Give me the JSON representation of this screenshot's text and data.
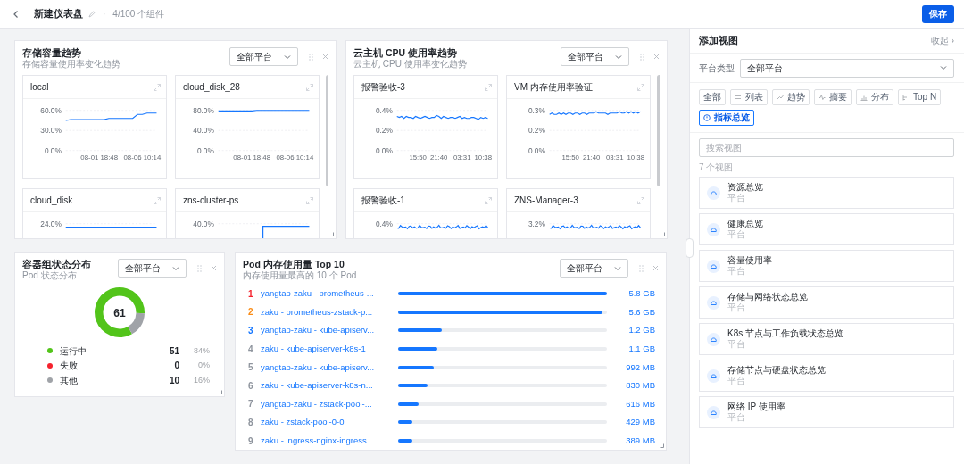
{
  "header": {
    "title": "新建仪表盘",
    "separator": "·",
    "count": "4/100 个组件",
    "save_button": "保存"
  },
  "widgets": [
    {
      "kind": "trend_grid",
      "title": "存储容量趋势",
      "subtitle": "存储容量使用率变化趋势",
      "platform_select": "全部平台",
      "charts": [
        {
          "kind": "line_chart",
          "title": "local",
          "chart_data": {
            "type": "line",
            "categories": [
              null,
              null,
              null,
              null,
              null,
              null,
              null,
              "08-01 18:48",
              null,
              null,
              null,
              null,
              null,
              null,
              null,
              null,
              "08-06 10:14",
              null,
              null,
              null
            ],
            "ylim": [
              0,
              60
            ],
            "yticks": [
              {
                "value": 0,
                "label": "0.0%"
              },
              {
                "value": 30,
                "label": "30.0%"
              },
              {
                "value": 60,
                "label": "60.0%"
              }
            ],
            "series": [
              {
                "color": "#1677ff",
                "values": [
                  45,
                  46,
                  46,
                  46,
                  46,
                  46,
                  46,
                  46,
                  46,
                  48,
                  48,
                  48,
                  48,
                  48,
                  48,
                  54,
                  54,
                  56,
                  56,
                  56
                ]
              }
            ]
          }
        },
        {
          "kind": "line_chart",
          "title": "cloud_disk_28",
          "chart_data": {
            "type": "line",
            "categories": [
              null,
              null,
              null,
              null,
              null,
              null,
              null,
              "08-01 18:48",
              null,
              null,
              null,
              null,
              null,
              null,
              null,
              null,
              "08-06 10:14",
              null,
              null,
              null
            ],
            "ylim": [
              0,
              80
            ],
            "yticks": [
              {
                "value": 0,
                "label": "0.0%"
              },
              {
                "value": 40,
                "label": "40.0%"
              },
              {
                "value": 80,
                "label": "80.0%"
              }
            ],
            "series": [
              {
                "color": "#1677ff",
                "values": [
                  79,
                  79,
                  79,
                  79,
                  79,
                  79,
                  79,
                  79,
                  80,
                  80,
                  80,
                  80,
                  80,
                  80,
                  80,
                  80,
                  80,
                  80,
                  80,
                  80
                ]
              }
            ]
          }
        },
        {
          "kind": "flat_trace",
          "title": "cloud_disk",
          "tick_labels": [
            "24.0%"
          ]
        },
        {
          "kind": "step_trace",
          "title": "zns-cluster-ps",
          "tick_labels": [
            "40.0%"
          ]
        }
      ]
    },
    {
      "kind": "trend_grid",
      "title": "云主机 CPU 使用率趋势",
      "subtitle": "云主机 CPU 使用率变化趋势",
      "platform_select": "全部平台",
      "charts": [
        {
          "kind": "line_chart",
          "title": "报警验收-3",
          "chart_data": {
            "type": "line",
            "categories": [
              null,
              null,
              null,
              null,
              null,
              null,
              null,
              null,
              null,
              "15:50",
              null,
              null,
              null,
              null,
              null,
              null,
              null,
              null,
              "21:40",
              null,
              null,
              null,
              null,
              null,
              null,
              null,
              null,
              null,
              "03:31",
              null,
              null,
              null,
              null,
              null,
              null,
              null,
              null,
              "10:38",
              null,
              null
            ],
            "ylim": [
              0,
              0.4
            ],
            "yticks": [
              {
                "value": 0,
                "label": "0.0%"
              },
              {
                "value": 0.2,
                "label": "0.2%"
              },
              {
                "value": 0.4,
                "label": "0.4%"
              }
            ],
            "series": [
              {
                "color": "#1677ff",
                "values": [
                  0.34,
                  0.33,
                  0.34,
                  0.32,
                  0.34,
                  0.33,
                  0.33,
                  0.32,
                  0.34,
                  0.33,
                  0.32,
                  0.33,
                  0.34,
                  0.33,
                  0.32,
                  0.33,
                  0.33,
                  0.35,
                  0.34,
                  0.32,
                  0.34,
                  0.33,
                  0.32,
                  0.33,
                  0.33,
                  0.32,
                  0.33,
                  0.34,
                  0.32,
                  0.33,
                  0.32,
                  0.32,
                  0.33,
                  0.33,
                  0.32,
                  0.31,
                  0.33,
                  0.32,
                  0.33,
                  0.32
                ]
              }
            ]
          }
        },
        {
          "kind": "line_chart",
          "title": "VM 内存使用率验证",
          "chart_data": {
            "type": "line",
            "categories": [
              null,
              null,
              null,
              null,
              null,
              null,
              null,
              null,
              null,
              "15:50",
              null,
              null,
              null,
              null,
              null,
              null,
              null,
              null,
              "21:40",
              null,
              null,
              null,
              null,
              null,
              null,
              null,
              null,
              null,
              "03:31",
              null,
              null,
              null,
              null,
              null,
              null,
              null,
              null,
              "10:38",
              null,
              null
            ],
            "ylim": [
              0,
              0.3
            ],
            "yticks": [
              {
                "value": 0,
                "label": "0.0%"
              },
              {
                "value": 0.15,
                "label": "0.2%"
              },
              {
                "value": 0.3,
                "label": "0.3%"
              }
            ],
            "series": [
              {
                "color": "#1677ff",
                "values": [
                  0.27,
                  0.28,
                  0.27,
                  0.27,
                  0.28,
                  0.27,
                  0.28,
                  0.27,
                  0.28,
                  0.28,
                  0.27,
                  0.28,
                  0.28,
                  0.27,
                  0.28,
                  0.28,
                  0.27,
                  0.28,
                  0.28,
                  0.28,
                  0.29,
                  0.28,
                  0.28,
                  0.28,
                  0.28,
                  0.27,
                  0.28,
                  0.28,
                  0.28,
                  0.28,
                  0.29,
                  0.28,
                  0.28,
                  0.29,
                  0.28,
                  0.29,
                  0.28,
                  0.29,
                  0.28,
                  0.29
                ]
              }
            ]
          }
        },
        {
          "kind": "noise_trace",
          "title": "报警验收-1",
          "tick_labels": [
            "0.4%"
          ]
        },
        {
          "kind": "noise_trace",
          "title": "ZNS-Manager-3",
          "tick_labels": [
            "3.2%"
          ]
        }
      ]
    },
    {
      "kind": "status_donut",
      "title": "容器组状态分布",
      "subtitle": "Pod 状态分布",
      "platform_select": "全部平台",
      "total": "61",
      "chart_data": {
        "type": "donut",
        "categories": [
          "运行中",
          "失败",
          "其他"
        ],
        "series": [
          {
            "values": [
              84,
              0,
              16
            ]
          }
        ]
      },
      "legend": [
        {
          "count": "51",
          "percent": "84%",
          "color": "#52c41a"
        },
        {
          "count": "0",
          "percent": "0%",
          "color": "#f5222d"
        },
        {
          "count": "10",
          "percent": "16%",
          "color": "#a0a3a8"
        }
      ]
    },
    {
      "kind": "top_list",
      "title": "Pod 内存使用量 Top 10",
      "subtitle": "内存使用量最高的 10 个 Pod",
      "platform_select": "全部平台",
      "items": [
        {
          "rank": "1",
          "color": "#f5222d",
          "name": "yangtao-zaku - prometheus-...",
          "level": 1.0,
          "value": "5.8 GB"
        },
        {
          "rank": "2",
          "color": "#fa8c16",
          "name": "zaku - prometheus-zstack-p...",
          "level": 0.98,
          "value": "5.6 GB"
        },
        {
          "rank": "3",
          "color": "#1677ff",
          "name": "yangtao-zaku - kube-apiserv...",
          "level": 0.21,
          "value": "1.2 GB"
        },
        {
          "rank": "4",
          "color": "#8f959e",
          "name": "zaku - kube-apiserver-k8s-1",
          "level": 0.19,
          "value": "1.1 GB"
        },
        {
          "rank": "5",
          "color": "#8f959e",
          "name": "yangtao-zaku - kube-apiserv...",
          "level": 0.17,
          "value": "992 MB"
        },
        {
          "rank": "6",
          "color": "#8f959e",
          "name": "zaku - kube-apiserver-k8s-n...",
          "level": 0.14,
          "value": "830 MB"
        },
        {
          "rank": "7",
          "color": "#8f959e",
          "name": "yangtao-zaku - zstack-pool-...",
          "level": 0.1,
          "value": "616 MB"
        },
        {
          "rank": "8",
          "color": "#8f959e",
          "name": "zaku - zstack-pool-0-0",
          "level": 0.07,
          "value": "429 MB"
        },
        {
          "rank": "9",
          "color": "#8f959e",
          "name": "zaku - ingress-nginx-ingress...",
          "level": 0.07,
          "value": "389 MB"
        }
      ]
    }
  ],
  "side_panel": {
    "title": "添加视图",
    "collapse_link": "收起 ›",
    "platform_label": "平台类型",
    "platform_select": "全部平台",
    "filters": [
      {
        "kind": "plain",
        "label": "全部",
        "selected": false
      },
      {
        "kind": "list",
        "label": "列表",
        "selected": false
      },
      {
        "kind": "trend",
        "label": "趋势",
        "selected": false
      },
      {
        "kind": "summary",
        "label": "摘要",
        "selected": false
      },
      {
        "kind": "distribution",
        "label": "分布",
        "selected": false
      },
      {
        "kind": "topn",
        "label": "Top N",
        "selected": false
      },
      {
        "kind": "overview",
        "label": "指标总览",
        "selected": true
      }
    ],
    "search": {
      "placeholder": "搜索视图"
    },
    "view_count": "7 个视图",
    "views": [
      {
        "title": "资源总览",
        "subtitle": "平台"
      },
      {
        "title": "健康总览",
        "subtitle": "平台"
      },
      {
        "title": "容量使用率",
        "subtitle": "平台"
      },
      {
        "title": "存储与网络状态总览",
        "subtitle": "平台"
      },
      {
        "title": "K8s 节点与工作负载状态总览",
        "subtitle": "平台"
      },
      {
        "title": "存储节点与硬盘状态总览",
        "subtitle": "平台"
      },
      {
        "title": "网络 IP 使用率",
        "subtitle": "平台"
      }
    ]
  }
}
